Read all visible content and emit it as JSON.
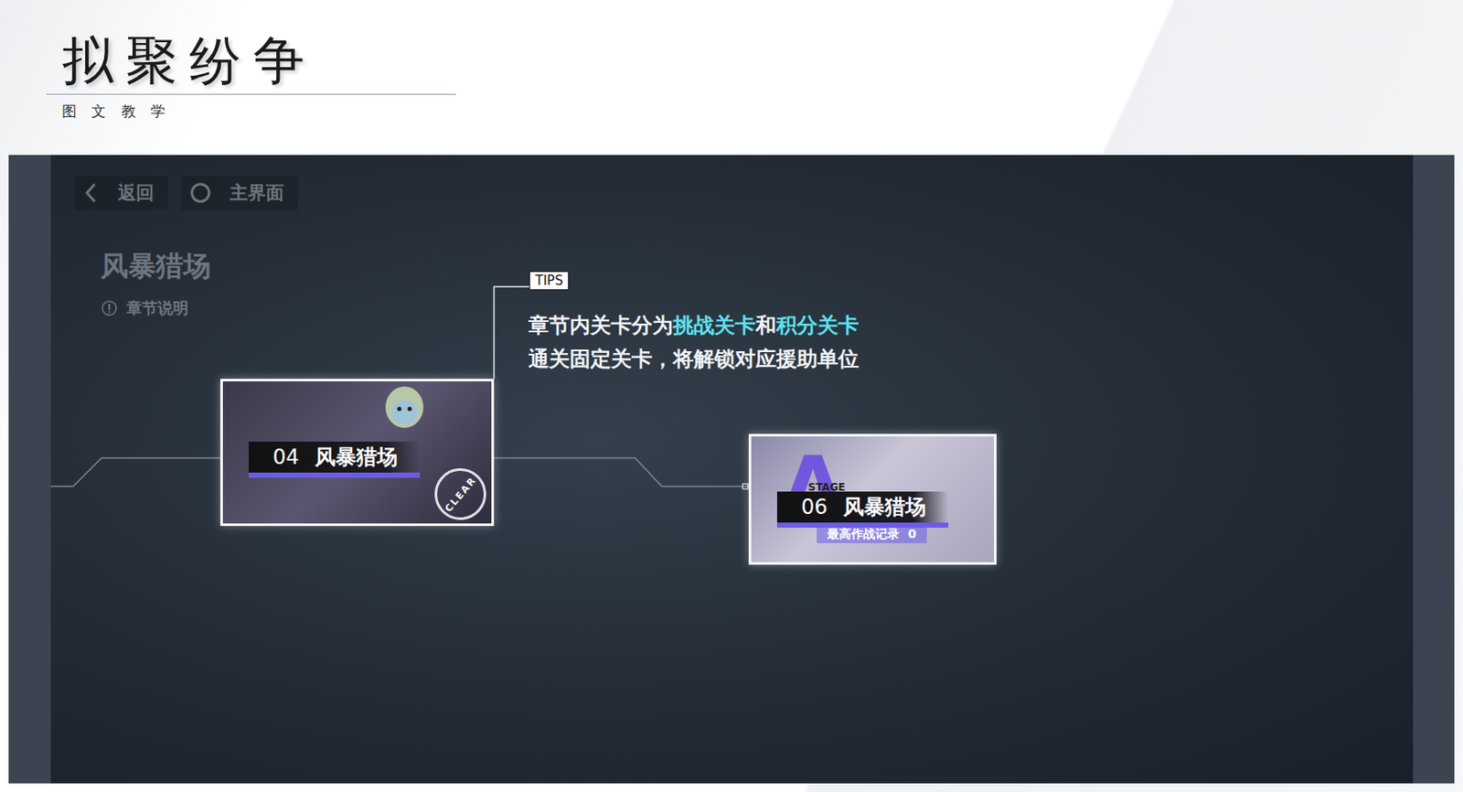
{
  "header": {
    "title": "拟聚纷争",
    "subtitle": "图 文 教 学"
  },
  "nav": [
    {
      "label": "返回",
      "kind": "back"
    },
    {
      "label": "主界面",
      "kind": "home"
    }
  ],
  "chapter": {
    "title": "风暴猎场",
    "info": "章节说明"
  },
  "tips": {
    "label": "TIPS",
    "lines": [
      [
        {
          "text": "章节内关卡分为",
          "highlight": false
        },
        {
          "text": "挑战关卡",
          "highlight": true
        },
        {
          "text": "和",
          "highlight": false
        },
        {
          "text": "积分关卡",
          "highlight": true
        }
      ],
      [
        {
          "text": "通关固定关卡，将解锁对应援助单位",
          "highlight": false
        }
      ]
    ]
  },
  "stages": [
    {
      "kind": "unit",
      "number": "04",
      "name": "风暴猎场",
      "cleared": true,
      "stamp": "CLEAR"
    },
    {
      "kind": "score",
      "number": "06",
      "name": "风暴猎场",
      "cleared": false,
      "grade": "A",
      "tag": "STAGE",
      "record_label": "最高作战记录",
      "record": "0"
    }
  ]
}
